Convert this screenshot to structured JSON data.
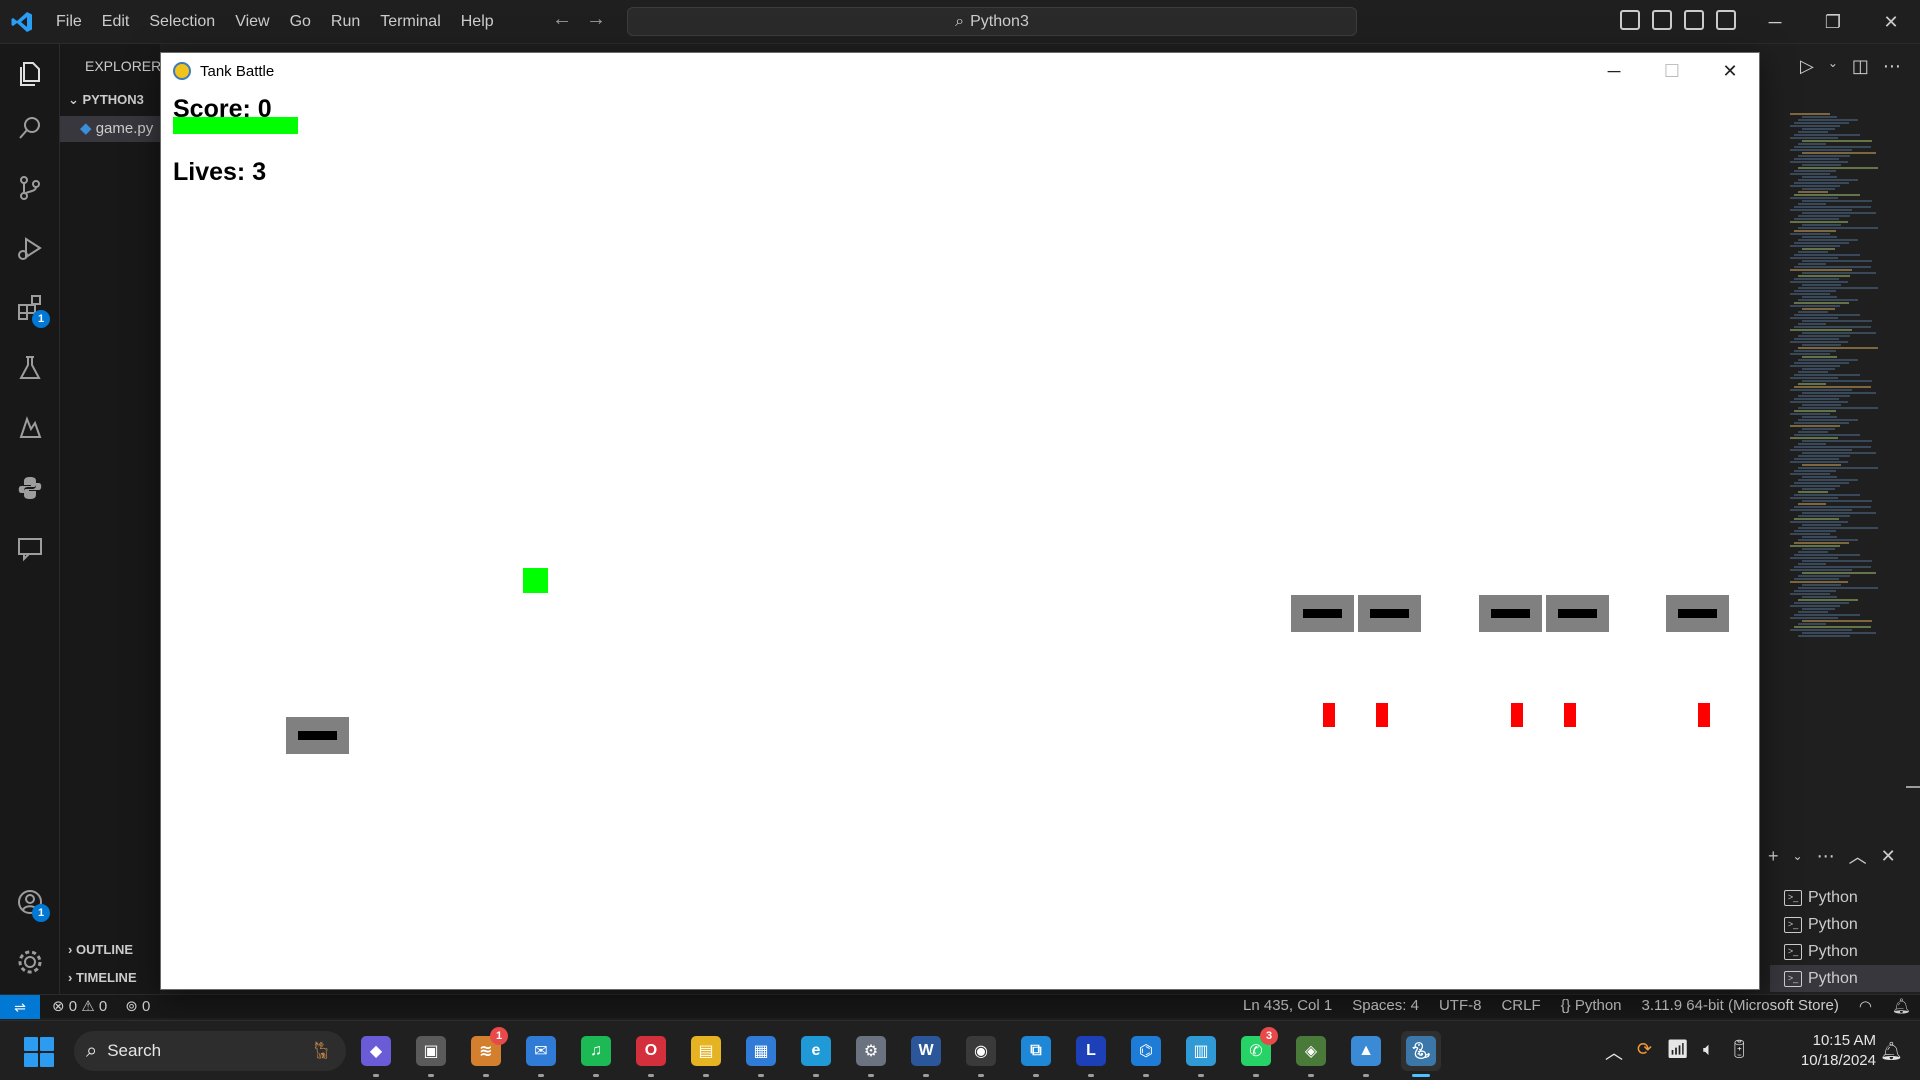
{
  "vscode": {
    "menu": [
      "File",
      "Edit",
      "Selection",
      "View",
      "Go",
      "Run",
      "Terminal",
      "Help"
    ],
    "command_center": "Python3",
    "explorer_title": "EXPLORER",
    "folder": "PYTHON3",
    "file": "game.py",
    "outline": "OUTLINE",
    "timeline": "TIMELINE",
    "badges": {
      "extensions": "1",
      "accounts": "1"
    },
    "terminals": [
      "Python",
      "Python",
      "Python",
      "Python"
    ]
  },
  "statusbar": {
    "errors": "0",
    "warnings": "0",
    "ports": "0",
    "position": "Ln 435, Col 1",
    "spaces": "Spaces: 4",
    "encoding": "UTF-8",
    "eol": "CRLF",
    "language": "Python",
    "interpreter": "3.11.9 64-bit (Microsoft Store)"
  },
  "game": {
    "window_title": "Tank Battle",
    "score_label": "Score: 0",
    "lives_label": "Lives: 3",
    "health_fraction": 1.0,
    "colors": {
      "player": "#00ff00",
      "tank": "#808080",
      "barrel": "#000000",
      "enemy_bullet": "#ff0000",
      "background": "#ffffff"
    }
  },
  "taskbar": {
    "search_placeholder": "Search",
    "apps": [
      {
        "name": "copilot",
        "badge": ""
      },
      {
        "name": "task-view",
        "badge": ""
      },
      {
        "name": "app-with-badge",
        "badge": "1"
      },
      {
        "name": "mail",
        "badge": ""
      },
      {
        "name": "spotify",
        "badge": ""
      },
      {
        "name": "opera",
        "badge": ""
      },
      {
        "name": "file-explorer",
        "badge": ""
      },
      {
        "name": "microsoft-store",
        "badge": ""
      },
      {
        "name": "edge",
        "badge": ""
      },
      {
        "name": "settings",
        "badge": ""
      },
      {
        "name": "word",
        "badge": ""
      },
      {
        "name": "obs",
        "badge": ""
      },
      {
        "name": "app-frame",
        "badge": ""
      },
      {
        "name": "letter-app",
        "badge": ""
      },
      {
        "name": "vscode",
        "badge": ""
      },
      {
        "name": "notepad",
        "badge": ""
      },
      {
        "name": "whatsapp",
        "badge": "3"
      },
      {
        "name": "app-secondary",
        "badge": ""
      },
      {
        "name": "photos",
        "badge": ""
      },
      {
        "name": "python",
        "badge": ""
      }
    ],
    "letter_app_label": "L",
    "time": "10:15 AM",
    "date": "10/18/2024"
  }
}
